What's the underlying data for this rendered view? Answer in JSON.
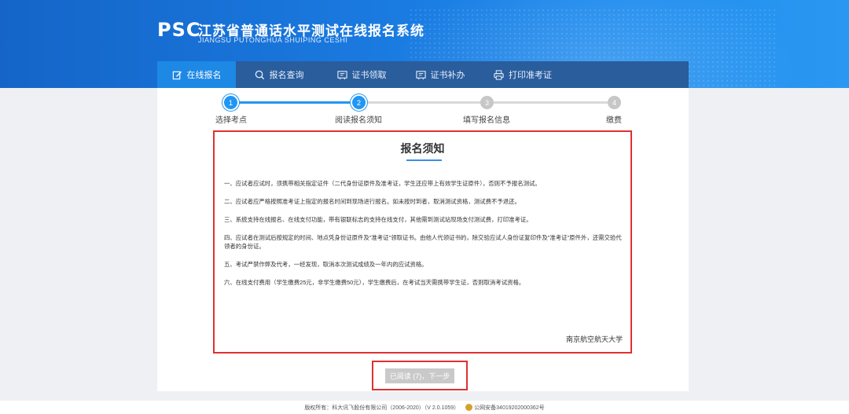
{
  "header": {
    "logo": "PSC",
    "title_cn": "江苏省普通话水平测试在线报名系统",
    "title_en": "JIANGSU PUTONGHUA SHUIPING CESHI"
  },
  "nav": {
    "items": [
      {
        "label": "在线报名",
        "icon": "edit-icon",
        "active": true
      },
      {
        "label": "报名查询",
        "icon": "search-icon",
        "active": false
      },
      {
        "label": "证书领取",
        "icon": "certificate-icon",
        "active": false
      },
      {
        "label": "证书补办",
        "icon": "certificate-icon",
        "active": false
      },
      {
        "label": "打印准考证",
        "icon": "printer-icon",
        "active": false
      }
    ]
  },
  "steps": [
    {
      "num": "1",
      "label": "选择考点",
      "done": true
    },
    {
      "num": "2",
      "label": "阅读报名须知",
      "done": true
    },
    {
      "num": "3",
      "label": "填写报名信息",
      "done": false
    },
    {
      "num": "4",
      "label": "缴费",
      "done": false
    }
  ],
  "notice": {
    "title": "报名须知",
    "paragraphs": [
      "一、应试者应试时，须携带相关指定证件（二代身份证原件及准考证，学生还应带上有效学生证原件），否则不予报名测试。",
      "二、应试者应严格按照准考证上指定的报名时间到现场进行报名。如未按时到者，取消测试资格，测试费不予退还。",
      "三、系统支持在线报名、在线支付功能，带有银联标志的支持在线支付，其他需到测试站现场支付测试费，打印准考证。",
      "四、应试者在测试后按规定的时间、地点凭身份证原件及\"准考证\"领取证书。由他人代领证书的，除交验应试人身份证复印件及\"准考证\"原件外，还需交验代领者的身份证。",
      "五、考试严禁作弊及代考，一经发现，取消本次测试成绩及一年内的应试资格。",
      "六、在线支付费用（学生缴费25元，非学生缴费50元），学生缴费后，在考试当天需携带学生证，否则取消考试资格。"
    ],
    "signature": "南京航空航天大学"
  },
  "next_button": {
    "label": "已阅读 (7)，下一步"
  },
  "footer": {
    "copyright": "版权所有：科大讯飞股份有限公司（2006-2020）（V 2.0.1059）",
    "icp": "公网安备34019202000362号"
  },
  "colors": {
    "primary": "#1e88e5",
    "nav_bg": "#2a5d9c",
    "highlight": "#e03030",
    "inactive": "#c7c7c7"
  }
}
